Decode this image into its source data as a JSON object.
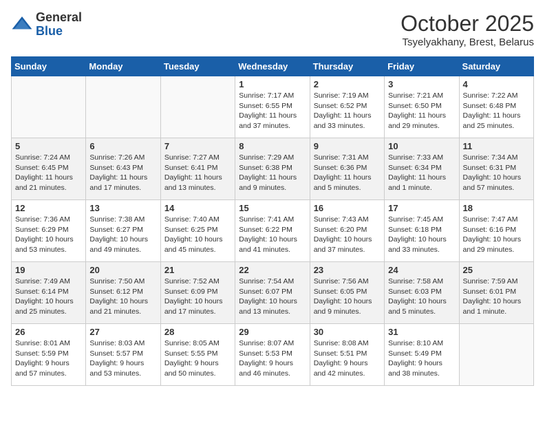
{
  "header": {
    "logo_general": "General",
    "logo_blue": "Blue",
    "title": "October 2025",
    "subtitle": "Tsyelyakhany, Brest, Belarus"
  },
  "weekdays": [
    "Sunday",
    "Monday",
    "Tuesday",
    "Wednesday",
    "Thursday",
    "Friday",
    "Saturday"
  ],
  "weeks": [
    [
      {
        "day": "",
        "info": ""
      },
      {
        "day": "",
        "info": ""
      },
      {
        "day": "",
        "info": ""
      },
      {
        "day": "1",
        "info": "Sunrise: 7:17 AM\nSunset: 6:55 PM\nDaylight: 11 hours and 37 minutes."
      },
      {
        "day": "2",
        "info": "Sunrise: 7:19 AM\nSunset: 6:52 PM\nDaylight: 11 hours and 33 minutes."
      },
      {
        "day": "3",
        "info": "Sunrise: 7:21 AM\nSunset: 6:50 PM\nDaylight: 11 hours and 29 minutes."
      },
      {
        "day": "4",
        "info": "Sunrise: 7:22 AM\nSunset: 6:48 PM\nDaylight: 11 hours and 25 minutes."
      }
    ],
    [
      {
        "day": "5",
        "info": "Sunrise: 7:24 AM\nSunset: 6:45 PM\nDaylight: 11 hours and 21 minutes."
      },
      {
        "day": "6",
        "info": "Sunrise: 7:26 AM\nSunset: 6:43 PM\nDaylight: 11 hours and 17 minutes."
      },
      {
        "day": "7",
        "info": "Sunrise: 7:27 AM\nSunset: 6:41 PM\nDaylight: 11 hours and 13 minutes."
      },
      {
        "day": "8",
        "info": "Sunrise: 7:29 AM\nSunset: 6:38 PM\nDaylight: 11 hours and 9 minutes."
      },
      {
        "day": "9",
        "info": "Sunrise: 7:31 AM\nSunset: 6:36 PM\nDaylight: 11 hours and 5 minutes."
      },
      {
        "day": "10",
        "info": "Sunrise: 7:33 AM\nSunset: 6:34 PM\nDaylight: 11 hours and 1 minute."
      },
      {
        "day": "11",
        "info": "Sunrise: 7:34 AM\nSunset: 6:31 PM\nDaylight: 10 hours and 57 minutes."
      }
    ],
    [
      {
        "day": "12",
        "info": "Sunrise: 7:36 AM\nSunset: 6:29 PM\nDaylight: 10 hours and 53 minutes."
      },
      {
        "day": "13",
        "info": "Sunrise: 7:38 AM\nSunset: 6:27 PM\nDaylight: 10 hours and 49 minutes."
      },
      {
        "day": "14",
        "info": "Sunrise: 7:40 AM\nSunset: 6:25 PM\nDaylight: 10 hours and 45 minutes."
      },
      {
        "day": "15",
        "info": "Sunrise: 7:41 AM\nSunset: 6:22 PM\nDaylight: 10 hours and 41 minutes."
      },
      {
        "day": "16",
        "info": "Sunrise: 7:43 AM\nSunset: 6:20 PM\nDaylight: 10 hours and 37 minutes."
      },
      {
        "day": "17",
        "info": "Sunrise: 7:45 AM\nSunset: 6:18 PM\nDaylight: 10 hours and 33 minutes."
      },
      {
        "day": "18",
        "info": "Sunrise: 7:47 AM\nSunset: 6:16 PM\nDaylight: 10 hours and 29 minutes."
      }
    ],
    [
      {
        "day": "19",
        "info": "Sunrise: 7:49 AM\nSunset: 6:14 PM\nDaylight: 10 hours and 25 minutes."
      },
      {
        "day": "20",
        "info": "Sunrise: 7:50 AM\nSunset: 6:12 PM\nDaylight: 10 hours and 21 minutes."
      },
      {
        "day": "21",
        "info": "Sunrise: 7:52 AM\nSunset: 6:09 PM\nDaylight: 10 hours and 17 minutes."
      },
      {
        "day": "22",
        "info": "Sunrise: 7:54 AM\nSunset: 6:07 PM\nDaylight: 10 hours and 13 minutes."
      },
      {
        "day": "23",
        "info": "Sunrise: 7:56 AM\nSunset: 6:05 PM\nDaylight: 10 hours and 9 minutes."
      },
      {
        "day": "24",
        "info": "Sunrise: 7:58 AM\nSunset: 6:03 PM\nDaylight: 10 hours and 5 minutes."
      },
      {
        "day": "25",
        "info": "Sunrise: 7:59 AM\nSunset: 6:01 PM\nDaylight: 10 hours and 1 minute."
      }
    ],
    [
      {
        "day": "26",
        "info": "Sunrise: 8:01 AM\nSunset: 5:59 PM\nDaylight: 9 hours and 57 minutes."
      },
      {
        "day": "27",
        "info": "Sunrise: 8:03 AM\nSunset: 5:57 PM\nDaylight: 9 hours and 53 minutes."
      },
      {
        "day": "28",
        "info": "Sunrise: 8:05 AM\nSunset: 5:55 PM\nDaylight: 9 hours and 50 minutes."
      },
      {
        "day": "29",
        "info": "Sunrise: 8:07 AM\nSunset: 5:53 PM\nDaylight: 9 hours and 46 minutes."
      },
      {
        "day": "30",
        "info": "Sunrise: 8:08 AM\nSunset: 5:51 PM\nDaylight: 9 hours and 42 minutes."
      },
      {
        "day": "31",
        "info": "Sunrise: 8:10 AM\nSunset: 5:49 PM\nDaylight: 9 hours and 38 minutes."
      },
      {
        "day": "",
        "info": ""
      }
    ]
  ]
}
